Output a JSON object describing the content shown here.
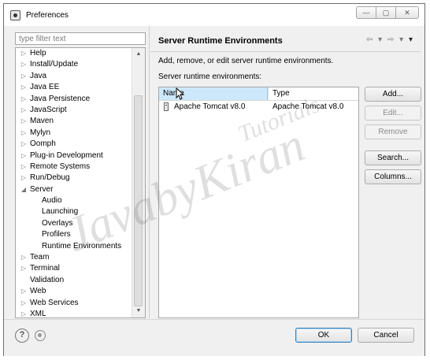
{
  "window": {
    "title": "Preferences",
    "buttons": {
      "minimize": "—",
      "maximize": "▢",
      "close": "✕"
    }
  },
  "sidebar": {
    "filter_placeholder": "type filter text",
    "items": [
      {
        "label": "Help",
        "arrow": "▷"
      },
      {
        "label": "Install/Update",
        "arrow": "▷"
      },
      {
        "label": "Java",
        "arrow": "▷"
      },
      {
        "label": "Java EE",
        "arrow": "▷"
      },
      {
        "label": "Java Persistence",
        "arrow": "▷"
      },
      {
        "label": "JavaScript",
        "arrow": "▷"
      },
      {
        "label": "Maven",
        "arrow": "▷"
      },
      {
        "label": "Mylyn",
        "arrow": "▷"
      },
      {
        "label": "Oomph",
        "arrow": "▷"
      },
      {
        "label": "Plug-in Development",
        "arrow": "▷"
      },
      {
        "label": "Remote Systems",
        "arrow": "▷"
      },
      {
        "label": "Run/Debug",
        "arrow": "▷"
      },
      {
        "label": "Server",
        "arrow": "◢"
      },
      {
        "label": "Audio",
        "arrow": ""
      },
      {
        "label": "Launching",
        "arrow": ""
      },
      {
        "label": "Overlays",
        "arrow": ""
      },
      {
        "label": "Profilers",
        "arrow": ""
      },
      {
        "label": "Runtime Environments",
        "arrow": ""
      },
      {
        "label": "Team",
        "arrow": "▷"
      },
      {
        "label": "Terminal",
        "arrow": "▷"
      },
      {
        "label": "Validation",
        "arrow": ""
      },
      {
        "label": "Web",
        "arrow": "▷"
      },
      {
        "label": "Web Services",
        "arrow": "▷"
      },
      {
        "label": "XML",
        "arrow": "▷"
      }
    ],
    "scroll_up": "▲",
    "scroll_down": "▼"
  },
  "main": {
    "title": "Server Runtime Environments",
    "nav": {
      "back": "⇦",
      "back_menu": "▾",
      "forward": "⇨",
      "forward_menu": "▾",
      "view_menu": "▾"
    },
    "description": "Add, remove, or edit server runtime environments.",
    "list_label": "Server runtime environments:",
    "table": {
      "columns": [
        "Name",
        "Type"
      ],
      "rows": [
        {
          "name": "Apache Tomcat v8.0",
          "type": "Apache Tomcat v8.0"
        }
      ]
    },
    "buttons": {
      "add": "Add...",
      "edit": "Edit...",
      "remove": "Remove",
      "search": "Search...",
      "columns": "Columns..."
    }
  },
  "footer": {
    "help_icon": "?",
    "ok": "OK",
    "cancel": "Cancel"
  },
  "watermark": {
    "line1": "JavabyKiran",
    "line2": "Tutorials"
  }
}
